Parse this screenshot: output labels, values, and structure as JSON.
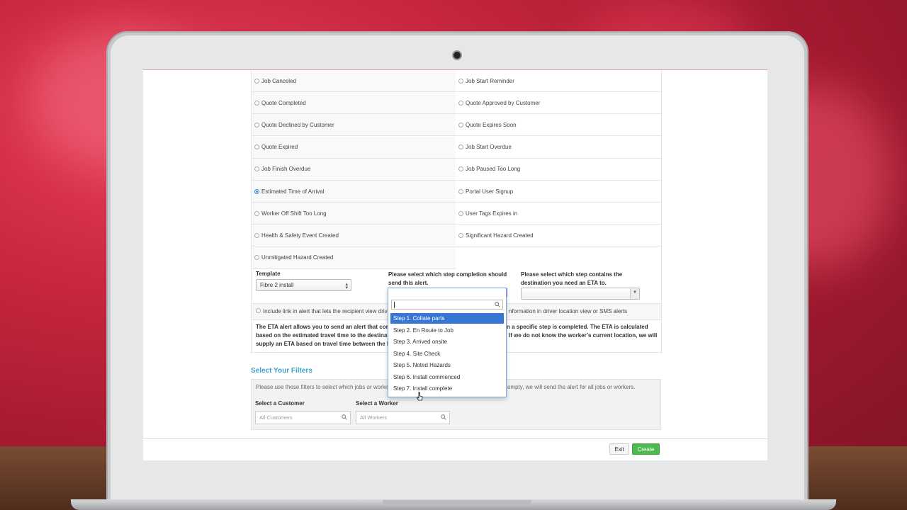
{
  "alert_types": {
    "left": [
      {
        "label": "Job Canceled",
        "selected": false
      },
      {
        "label": "Quote Completed",
        "selected": false
      },
      {
        "label": "Quote Declined by Customer",
        "selected": false
      },
      {
        "label": "Quote Expired",
        "selected": false
      },
      {
        "label": "Job Finish Overdue",
        "selected": false
      },
      {
        "label": "Estimated Time of Arrival",
        "selected": true
      },
      {
        "label": "Worker Off Shift Too Long",
        "selected": false
      },
      {
        "label": "Health & Safety Event Created",
        "selected": false
      },
      {
        "label": "Unmitigated Hazard Created",
        "selected": false
      }
    ],
    "right": [
      {
        "label": "Job Start Reminder",
        "selected": false
      },
      {
        "label": "Quote Approved by Customer",
        "selected": false
      },
      {
        "label": "Quote Expires Soon",
        "selected": false
      },
      {
        "label": "Job Start Overdue",
        "selected": false
      },
      {
        "label": "Job Paused Too Long",
        "selected": false
      },
      {
        "label": "Portal User Signup",
        "selected": false
      },
      {
        "label": "User Tags Expires in",
        "selected": false
      },
      {
        "label": "Significant Hazard Created",
        "selected": false
      }
    ]
  },
  "settings": {
    "template_label": "Template",
    "template_value": "Fibre 2 install",
    "step_completion_label": "Please select which step completion should send this alert.",
    "destination_label": "Please select which step contains the destination you need an ETA to.",
    "include_link_left": "Include link in alert that lets the recipient view drive",
    "include_link_right": "nformation in driver location view or SMS alerts",
    "eta_desc_lines": [
      {
        "left": "The ETA alert allows you to send an alert that con",
        "right": "n a specific step is completed. The ETA is calculated"
      },
      {
        "left": "based on the estimated travel time to the destinat",
        "right": "If we do not know the worker’s current location, we will"
      },
      {
        "left": "supply an ETA based on travel time between the l",
        "right": ""
      }
    ]
  },
  "step_dropdown": {
    "search_value": "",
    "options": [
      "Step 1. Collate parts",
      "Step 2. En Route to Job",
      "Step 3. Arrived onsite",
      "Step 4. Site Check",
      "Step 5. Noted Hazards",
      "Step 6. Install commenced",
      "Step 7. Install complete"
    ],
    "highlighted_index": 0
  },
  "filters": {
    "title": "Select Your Filters",
    "help_left": "Please use these filters to select which jobs or worke",
    "help_right": "empty, we will send the alert for all jobs or workers.",
    "customer_label": "Select a Customer",
    "customer_placeholder": "All Customers",
    "worker_label": "Select a Worker",
    "worker_placeholder": "All Workers"
  },
  "footer": {
    "exit_label": "Exit",
    "create_label": "Create"
  },
  "colors": {
    "accent_blue": "#3876d6",
    "section_title": "#3ea0c8",
    "create_green": "#4cba4f"
  }
}
